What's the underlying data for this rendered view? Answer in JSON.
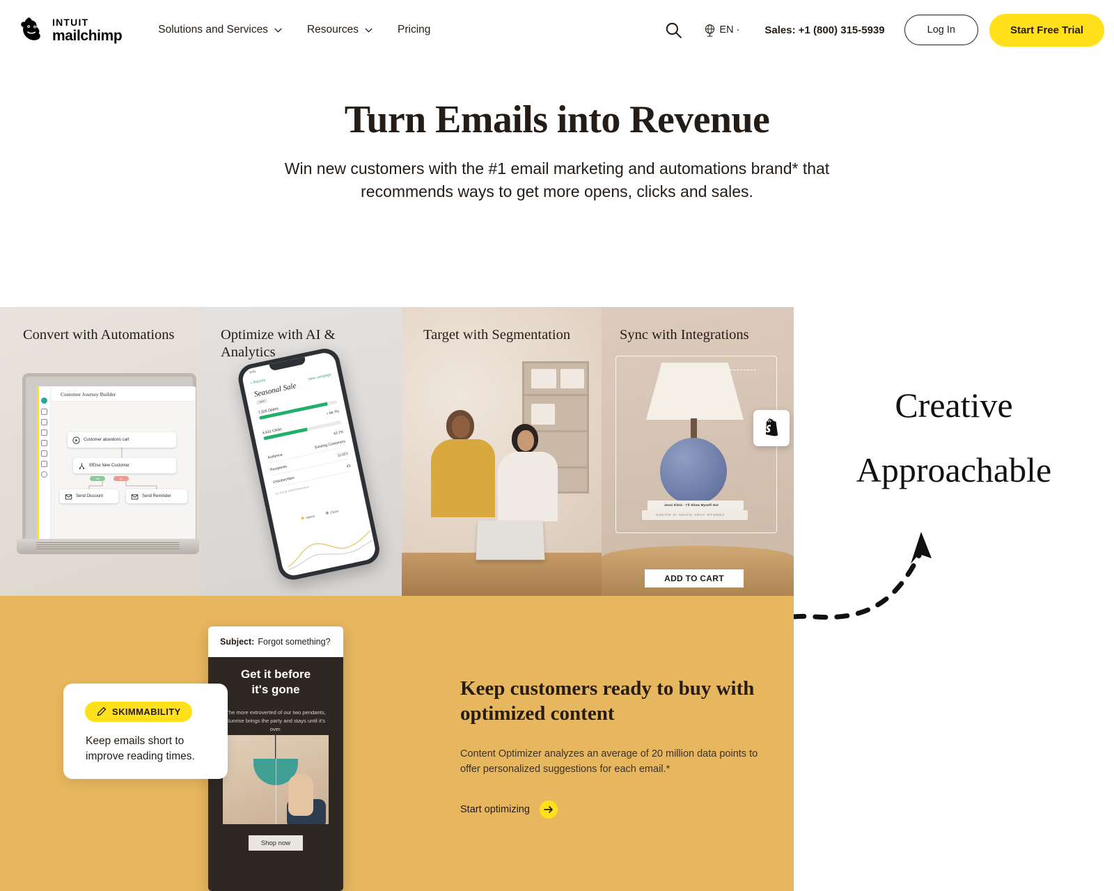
{
  "header": {
    "logo": {
      "intuit": "INTUIT",
      "mailchimp": "mailchimp",
      "icon": "mailchimp-chimp-icon"
    },
    "nav": [
      {
        "label": "Solutions and Services",
        "has_chevron": true
      },
      {
        "label": "Resources",
        "has_chevron": true
      },
      {
        "label": "Pricing",
        "has_chevron": false
      }
    ],
    "search_icon": "search-icon",
    "globe_icon": "globe-icon",
    "language": "EN",
    "sales": "Sales: +1 (800) 315-5939",
    "login_label": "Log In",
    "trial_label": "Start Free Trial"
  },
  "hero": {
    "title": "Turn Emails into Revenue",
    "subtitle": "Win new customers with the #1 email marketing and automations brand* that recommends ways to get more opens, clicks and sales."
  },
  "panels": [
    {
      "title": "Convert with Automations"
    },
    {
      "title": "Optimize with AI & Analytics"
    },
    {
      "title": "Target with Segmentation"
    },
    {
      "title": "Sync with Integrations"
    }
  ],
  "journey": {
    "app_title": "Customer Journey Builder",
    "nodes": [
      {
        "label": "Customer abandons cart",
        "icon": "play-circle-icon"
      },
      {
        "label": "If/Else New Customer",
        "icon": "branch-icon"
      },
      {
        "label": "Send Discount",
        "icon": "envelope-icon"
      },
      {
        "label": "Send Reminder",
        "icon": "envelope-icon"
      }
    ],
    "yes_label": "Yes",
    "no_label": "No"
  },
  "analytics": {
    "status_time": "9:41",
    "back_label": "< Reports",
    "view_campaign": "View campaign",
    "campaign_title": "Seasonal Sale",
    "campaign_badge": "Sent",
    "metrics": [
      {
        "label": "7,326 Opens",
        "value": "+ 66.7%",
        "fill": 88
      },
      {
        "label": "4,631 Clicks",
        "value": "42.1%",
        "fill": 56
      }
    ],
    "stats": [
      {
        "label": "Audience",
        "value": "Existing Customers"
      },
      {
        "label": "Recipients",
        "value": "11,021"
      },
      {
        "label": "Unsubscribes",
        "value": "43"
      }
    ],
    "perf_label": "24 HOUR PERFORMANCE",
    "legend": [
      {
        "label": "Opens",
        "color": "#f0c419"
      },
      {
        "label": "Clicks",
        "color": "#9aa3ad"
      }
    ]
  },
  "product": {
    "add_to_cart": "ADD TO CART",
    "integration_icon": "shopify-icon",
    "book_1": "Jessi Klein · I'll Show Myself Out",
    "book_2": "Camille et Vanille      ARAY OTUNGA"
  },
  "brand_words": {
    "line1": "Creative",
    "line2": "Approachable"
  },
  "gold": {
    "heading": "Keep customers ready to buy with optimized content",
    "body": "Content Optimizer analyzes an average of 20 million data points to offer personalized suggestions for each email.*",
    "cta": "Start optimizing",
    "cta_icon": "arrow-right-icon",
    "skim_badge": "SKIMMABILITY",
    "skim_badge_icon": "pencil-icon",
    "skim_text": "Keep emails short to improve reading times.",
    "email": {
      "subject_label": "Subject:",
      "subject_value": "Forgot something?",
      "headline": "Get it before\nit's gone",
      "body": "The more extroverted of our two pendants, Sunrise brings the party and stays until it's over.",
      "button": "Shop now"
    }
  },
  "colors": {
    "brand_yellow": "#ffe01b",
    "gold_section": "#e7b75f",
    "ink": "#241c15",
    "green": "#1fb16b"
  }
}
